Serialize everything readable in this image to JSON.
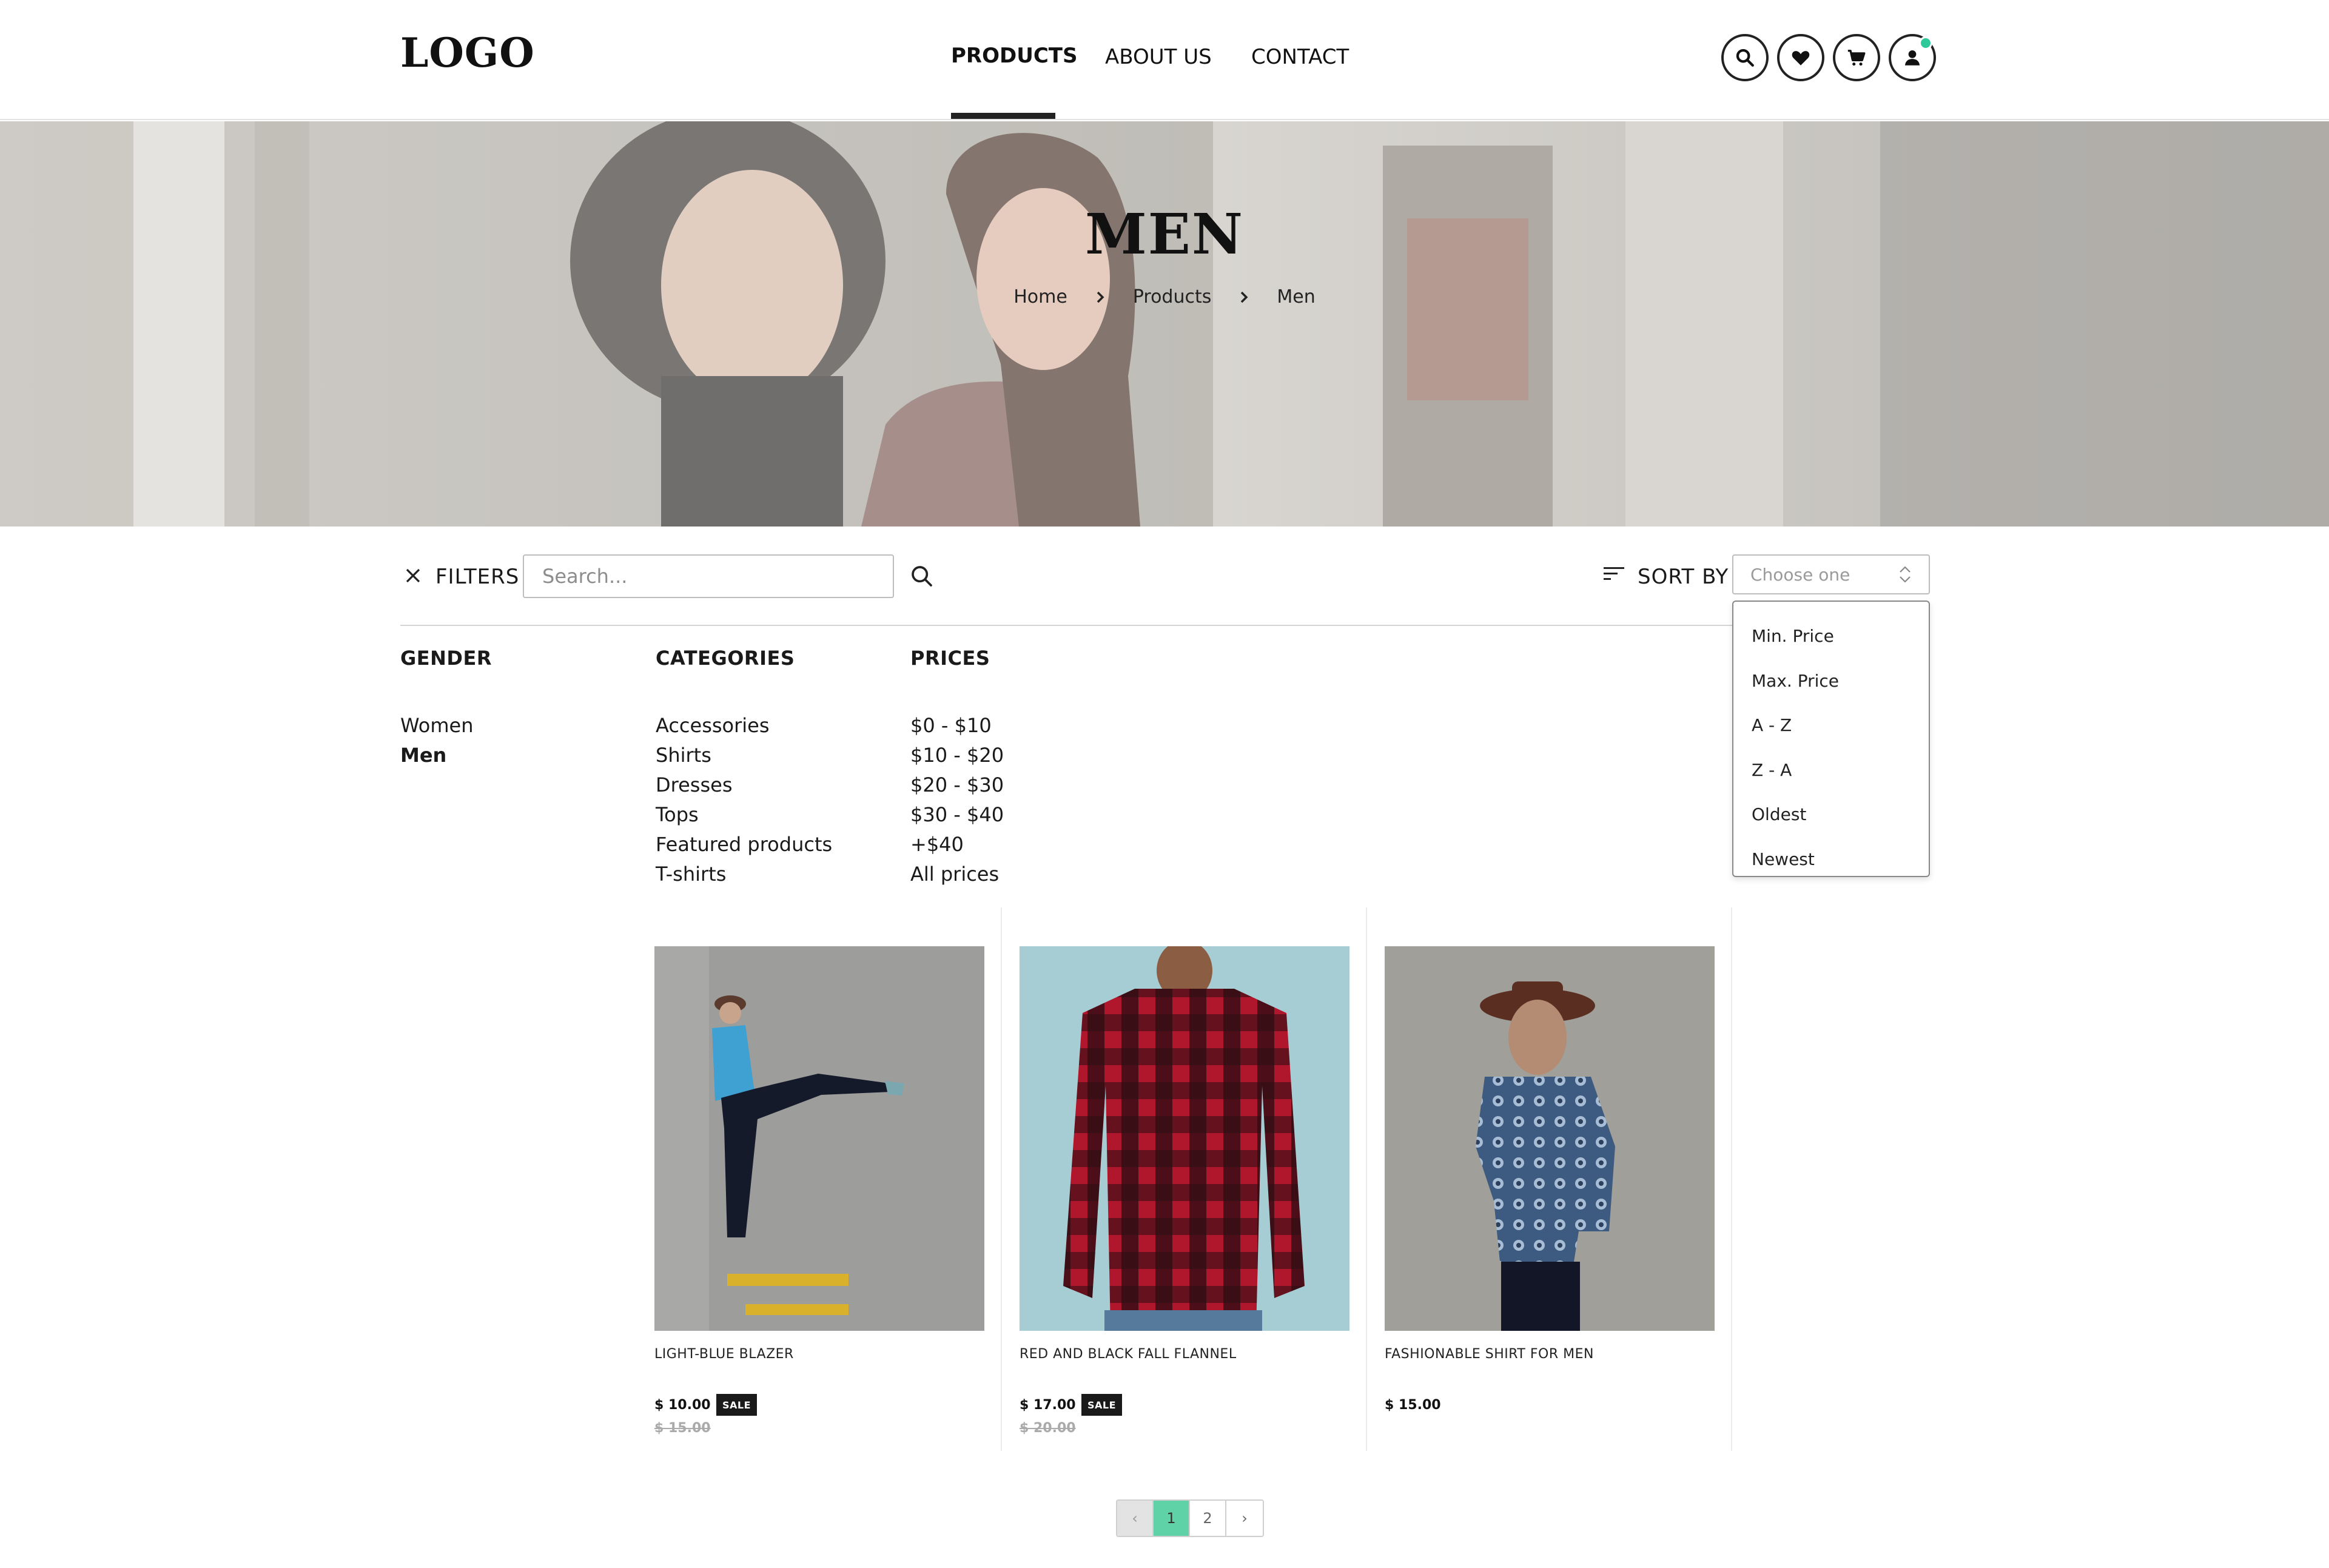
{
  "header": {
    "logo": "LOGO",
    "nav": [
      {
        "label": "PRODUCTS",
        "active": true
      },
      {
        "label": "ABOUT US",
        "active": false
      },
      {
        "label": "CONTACT",
        "active": false
      }
    ],
    "icons": [
      "search-icon",
      "heart-icon",
      "cart-icon",
      "user-icon"
    ],
    "notification_color": "#2ec999"
  },
  "hero": {
    "title": "MEN",
    "breadcrumb": [
      "Home",
      "Products",
      "Men"
    ]
  },
  "filters": {
    "label": "FILTERS",
    "search_placeholder": "Search...",
    "sort_label": "SORT BY",
    "sort_placeholder": "Choose one",
    "sort_options": [
      "Min. Price",
      "Max. Price",
      "A - Z",
      "Z - A",
      "Oldest",
      "Newest"
    ],
    "columns": {
      "gender": {
        "title": "GENDER",
        "items": [
          "Women",
          "Men"
        ],
        "selected": "Men"
      },
      "categories": {
        "title": "CATEGORIES",
        "items": [
          "Accessories",
          "Shirts",
          "Dresses",
          "Tops",
          "Featured products",
          "T-shirts"
        ]
      },
      "prices": {
        "title": "PRICES",
        "items": [
          "$0 - $10",
          "$10 - $20",
          "$20 - $30",
          "$30 - $40",
          "+$40",
          "All prices"
        ]
      }
    }
  },
  "products": [
    {
      "name": "LIGHT-BLUE BLAZER",
      "price": "$ 10.00",
      "old_price": "$ 15.00",
      "badge": "SALE"
    },
    {
      "name": "RED AND BLACK FALL FLANNEL",
      "price": "$ 17.00",
      "old_price": "$ 20.00",
      "badge": "SALE"
    },
    {
      "name": "FASHIONABLE SHIRT FOR MEN",
      "price": "$ 15.00"
    }
  ],
  "pagination": {
    "prev": "‹",
    "pages": [
      "1",
      "2"
    ],
    "current": "1",
    "next": "›"
  },
  "colors": {
    "accent": "#5fd3a7",
    "dark": "#1a1a1a"
  }
}
